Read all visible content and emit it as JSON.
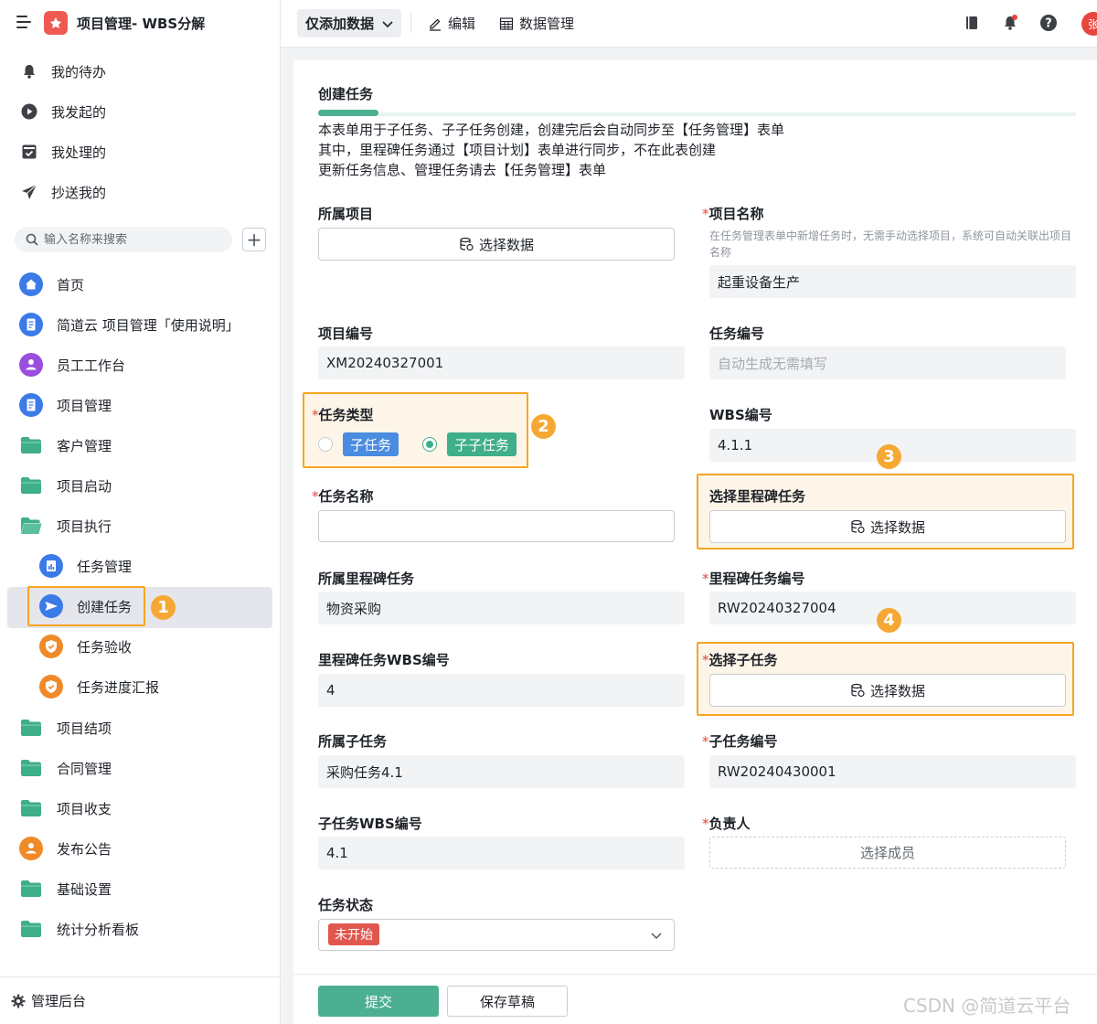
{
  "app": {
    "title": "项目管理- WBS分解"
  },
  "quick_links": [
    {
      "label": "我的待办",
      "icon": "bell-icon"
    },
    {
      "label": "我发起的",
      "icon": "play-circle-icon"
    },
    {
      "label": "我处理的",
      "icon": "inbox-check-icon"
    },
    {
      "label": "抄送我的",
      "icon": "paper-plane-icon"
    }
  ],
  "search": {
    "placeholder": "输入名称来搜索"
  },
  "nav": [
    {
      "label": "首页",
      "icon": "home-icon"
    },
    {
      "label": "简道云 项目管理「使用说明」",
      "icon": "document-icon"
    },
    {
      "label": "员工工作台",
      "icon": "user-icon"
    },
    {
      "label": "项目管理",
      "icon": "document-icon"
    },
    {
      "label": "客户管理",
      "icon": "folder-icon"
    },
    {
      "label": "项目启动",
      "icon": "folder-icon"
    },
    {
      "label": "项目执行",
      "icon": "folder-open-icon"
    },
    {
      "label": "任务管理",
      "icon": "report-icon"
    },
    {
      "label": "创建任务",
      "icon": "send-icon"
    },
    {
      "label": "任务验收",
      "icon": "shield-check-icon"
    },
    {
      "label": "任务进度汇报",
      "icon": "shield-check-icon"
    },
    {
      "label": "项目结项",
      "icon": "folder-icon"
    },
    {
      "label": "合同管理",
      "icon": "folder-icon"
    },
    {
      "label": "项目收支",
      "icon": "folder-icon"
    },
    {
      "label": "发布公告",
      "icon": "user-icon"
    },
    {
      "label": "基础设置",
      "icon": "folder-icon"
    },
    {
      "label": "统计分析看板",
      "icon": "folder-icon"
    }
  ],
  "admin": {
    "label": "管理后台"
  },
  "toolbar": {
    "view_label": "仅添加数据",
    "edit_label": "编辑",
    "data_mgmt_label": "数据管理",
    "avatar_text": "张"
  },
  "badges": {
    "b1": "1",
    "b2": "2",
    "b3": "3",
    "b4": "4"
  },
  "form": {
    "title": "创建任务",
    "progress": 0.08,
    "description": [
      "本表单用于子任务、子子任务创建，创建完后会自动同步至【任务管理】表单",
      "其中，里程碑任务通过【项目计划】表单进行同步，不在此表创建",
      "更新任务信息、管理任务请去【任务管理】表单"
    ],
    "select_data_label": "选择数据",
    "fields": {
      "project": {
        "label": "所属项目"
      },
      "project_name": {
        "label": "项目名称",
        "hint": "在任务管理表单中新增任务时，无需手动选择项目，系统可自动关联出项目名称",
        "value": "起重设备生产"
      },
      "project_no": {
        "label": "项目编号",
        "value": "XM20240327001"
      },
      "task_no": {
        "label": "任务编号",
        "placeholder": "自动生成无需填写"
      },
      "task_type": {
        "label": "任务类型",
        "options": [
          "子任务",
          "子子任务"
        ],
        "selected": "子子任务"
      },
      "wbs_no": {
        "label": "WBS编号",
        "value": "4.1.1"
      },
      "task_name": {
        "label": "任务名称",
        "value": ""
      },
      "select_milestone": {
        "label": "选择里程碑任务"
      },
      "milestone": {
        "label": "所属里程碑任务",
        "value": "物资采购"
      },
      "milestone_no": {
        "label": "里程碑任务编号",
        "value": "RW20240327004"
      },
      "milestone_wbs": {
        "label": "里程碑任务WBS编号",
        "value": "4"
      },
      "select_subtask": {
        "label": "选择子任务"
      },
      "subtask": {
        "label": "所属子任务",
        "value": "采购任务4.1"
      },
      "subtask_no": {
        "label": "子任务编号",
        "value": "RW20240430001"
      },
      "subtask_wbs": {
        "label": "子任务WBS编号",
        "value": "4.1"
      },
      "owner": {
        "label": "负责人",
        "button": "选择成员"
      },
      "status": {
        "label": "任务状态",
        "value": "未开始"
      }
    },
    "submit_label": "提交",
    "draft_label": "保存草稿"
  },
  "watermark": "CSDN @简道云平台",
  "colors": {
    "accent": "#4caf92",
    "highlight": "#f5a623",
    "danger": "#e8453c",
    "chip_blue": "#4a8cdf"
  }
}
